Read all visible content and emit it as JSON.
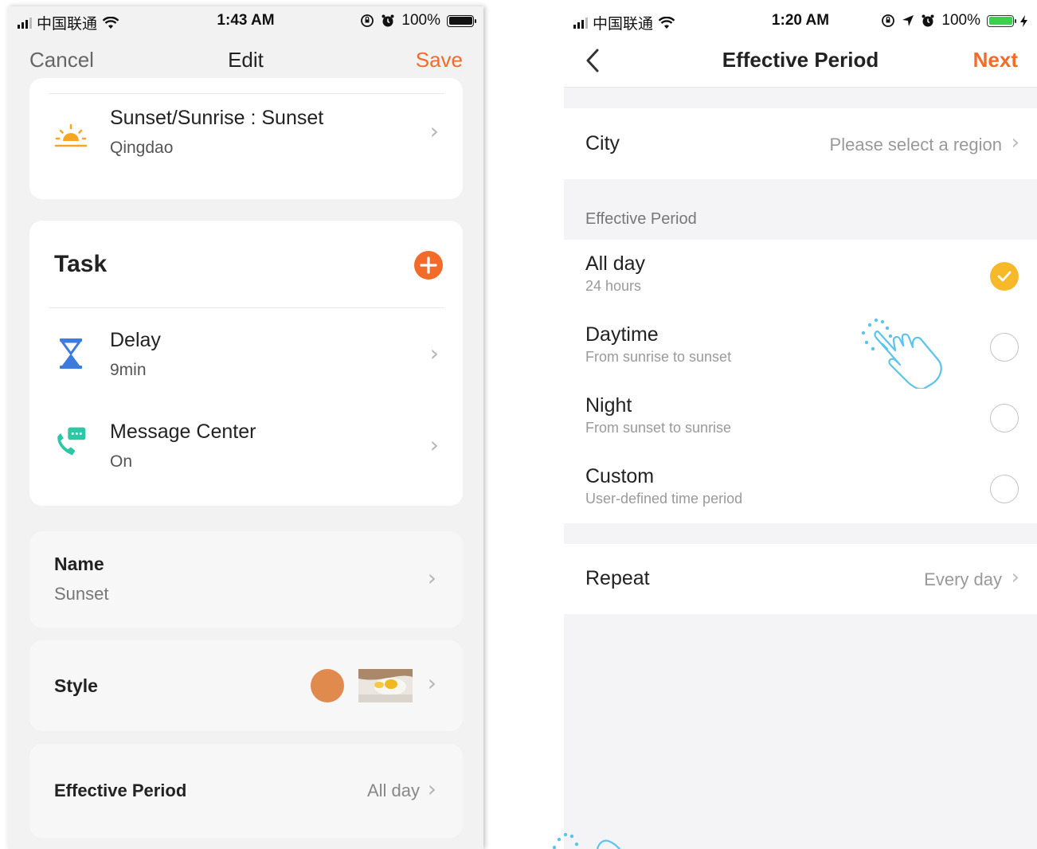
{
  "left": {
    "status": {
      "carrier": "中国联通",
      "time": "1:43 AM",
      "battery": "100%"
    },
    "nav": {
      "cancel": "Cancel",
      "title": "Edit",
      "save": "Save"
    },
    "condition": {
      "title": "Sunset/Sunrise : Sunset",
      "subtitle": "Qingdao",
      "icon": "sunset-icon"
    },
    "task": {
      "header": "Task",
      "add_icon": "plus-circle-icon",
      "items": [
        {
          "title": "Delay",
          "subtitle": "9min",
          "icon": "hourglass-icon"
        },
        {
          "title": "Message Center",
          "subtitle": "On",
          "icon": "message-phone-icon"
        }
      ]
    },
    "name": {
      "label": "Name",
      "value": "Sunset"
    },
    "style": {
      "label": "Style",
      "color": "#e08a4e"
    },
    "effective_period": {
      "label": "Effective Period",
      "value": "All day"
    }
  },
  "right": {
    "status": {
      "carrier": "中国联通",
      "time": "1:20 AM",
      "battery": "100%"
    },
    "nav": {
      "title": "Effective Period",
      "next": "Next"
    },
    "city": {
      "label": "City",
      "value": "Please select a region"
    },
    "group_header": "Effective Period",
    "options": [
      {
        "title": "All day",
        "subtitle": "24 hours",
        "selected": true
      },
      {
        "title": "Daytime",
        "subtitle": "From sunrise to sunset",
        "selected": false
      },
      {
        "title": "Night",
        "subtitle": "From sunset to sunrise",
        "selected": false
      },
      {
        "title": "Custom",
        "subtitle": "User-defined time period",
        "selected": false
      }
    ],
    "repeat": {
      "label": "Repeat",
      "value": "Every day"
    }
  },
  "colors": {
    "accent_orange": "#f26b2b",
    "check_yellow": "#f7b929",
    "hint_blue": "#5bc4ee"
  }
}
